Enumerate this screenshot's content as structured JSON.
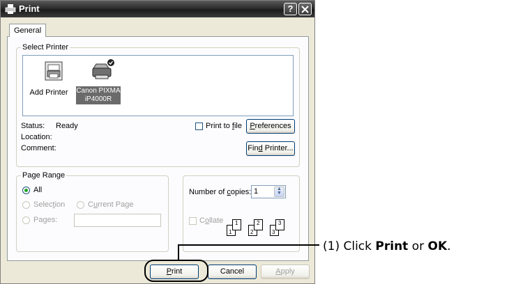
{
  "window": {
    "title": "Print"
  },
  "tabs": [
    {
      "label": "General"
    }
  ],
  "select_printer": {
    "legend": "Select Printer",
    "printers": [
      {
        "name": "Add Printer",
        "icon": "add-printer-icon"
      },
      {
        "name_line1": "Canon PIXMA",
        "name_line2": "iP4000R",
        "icon": "printer-icon",
        "selected": true
      }
    ],
    "status_label": "Status:",
    "status_value": "Ready",
    "location_label": "Location:",
    "comment_label": "Comment:",
    "print_to_file": {
      "label_pre": "Print to ",
      "label_accel": "f",
      "label_post": "ile",
      "checked": false
    },
    "preferences": {
      "label_accel": "P",
      "label_rest": "references"
    },
    "find_printer": {
      "label_pre": "Fin",
      "label_accel": "d",
      "label_post": " Printer..."
    }
  },
  "page_range": {
    "legend": "Page Range",
    "all": {
      "label": "All",
      "selected": true
    },
    "selection": {
      "label_pre": "Selec",
      "label_accel": "t",
      "label_post": "ion"
    },
    "current_page": {
      "label_pre": "C",
      "label_accel": "u",
      "label_post": "rrent Page"
    },
    "pages": {
      "label_pre": "Pa",
      "label_accel": "g",
      "label_post": "es:",
      "value": ""
    }
  },
  "copies": {
    "label_pre": "Number of ",
    "label_accel": "c",
    "label_post": "opies:",
    "value": "1",
    "collate": {
      "label_pre": "C",
      "label_accel": "o",
      "label_post": "llate",
      "checked": false
    },
    "page_icons": [
      "1",
      "1",
      "2",
      "2",
      "3",
      "3"
    ]
  },
  "buttons": {
    "print": {
      "label_accel": "P",
      "label_rest": "rint"
    },
    "cancel": {
      "label": "Cancel"
    },
    "apply": {
      "label_accel": "A",
      "label_rest": "pply"
    }
  },
  "callout": {
    "prefix": "(1) Click ",
    "word1": "Print",
    "middle": " or ",
    "word2": "OK",
    "suffix": "."
  },
  "colors": {
    "title_bar": "#2c2c2c",
    "dialog_bg": "#ece9d8",
    "radio_dot": "#21a121"
  }
}
